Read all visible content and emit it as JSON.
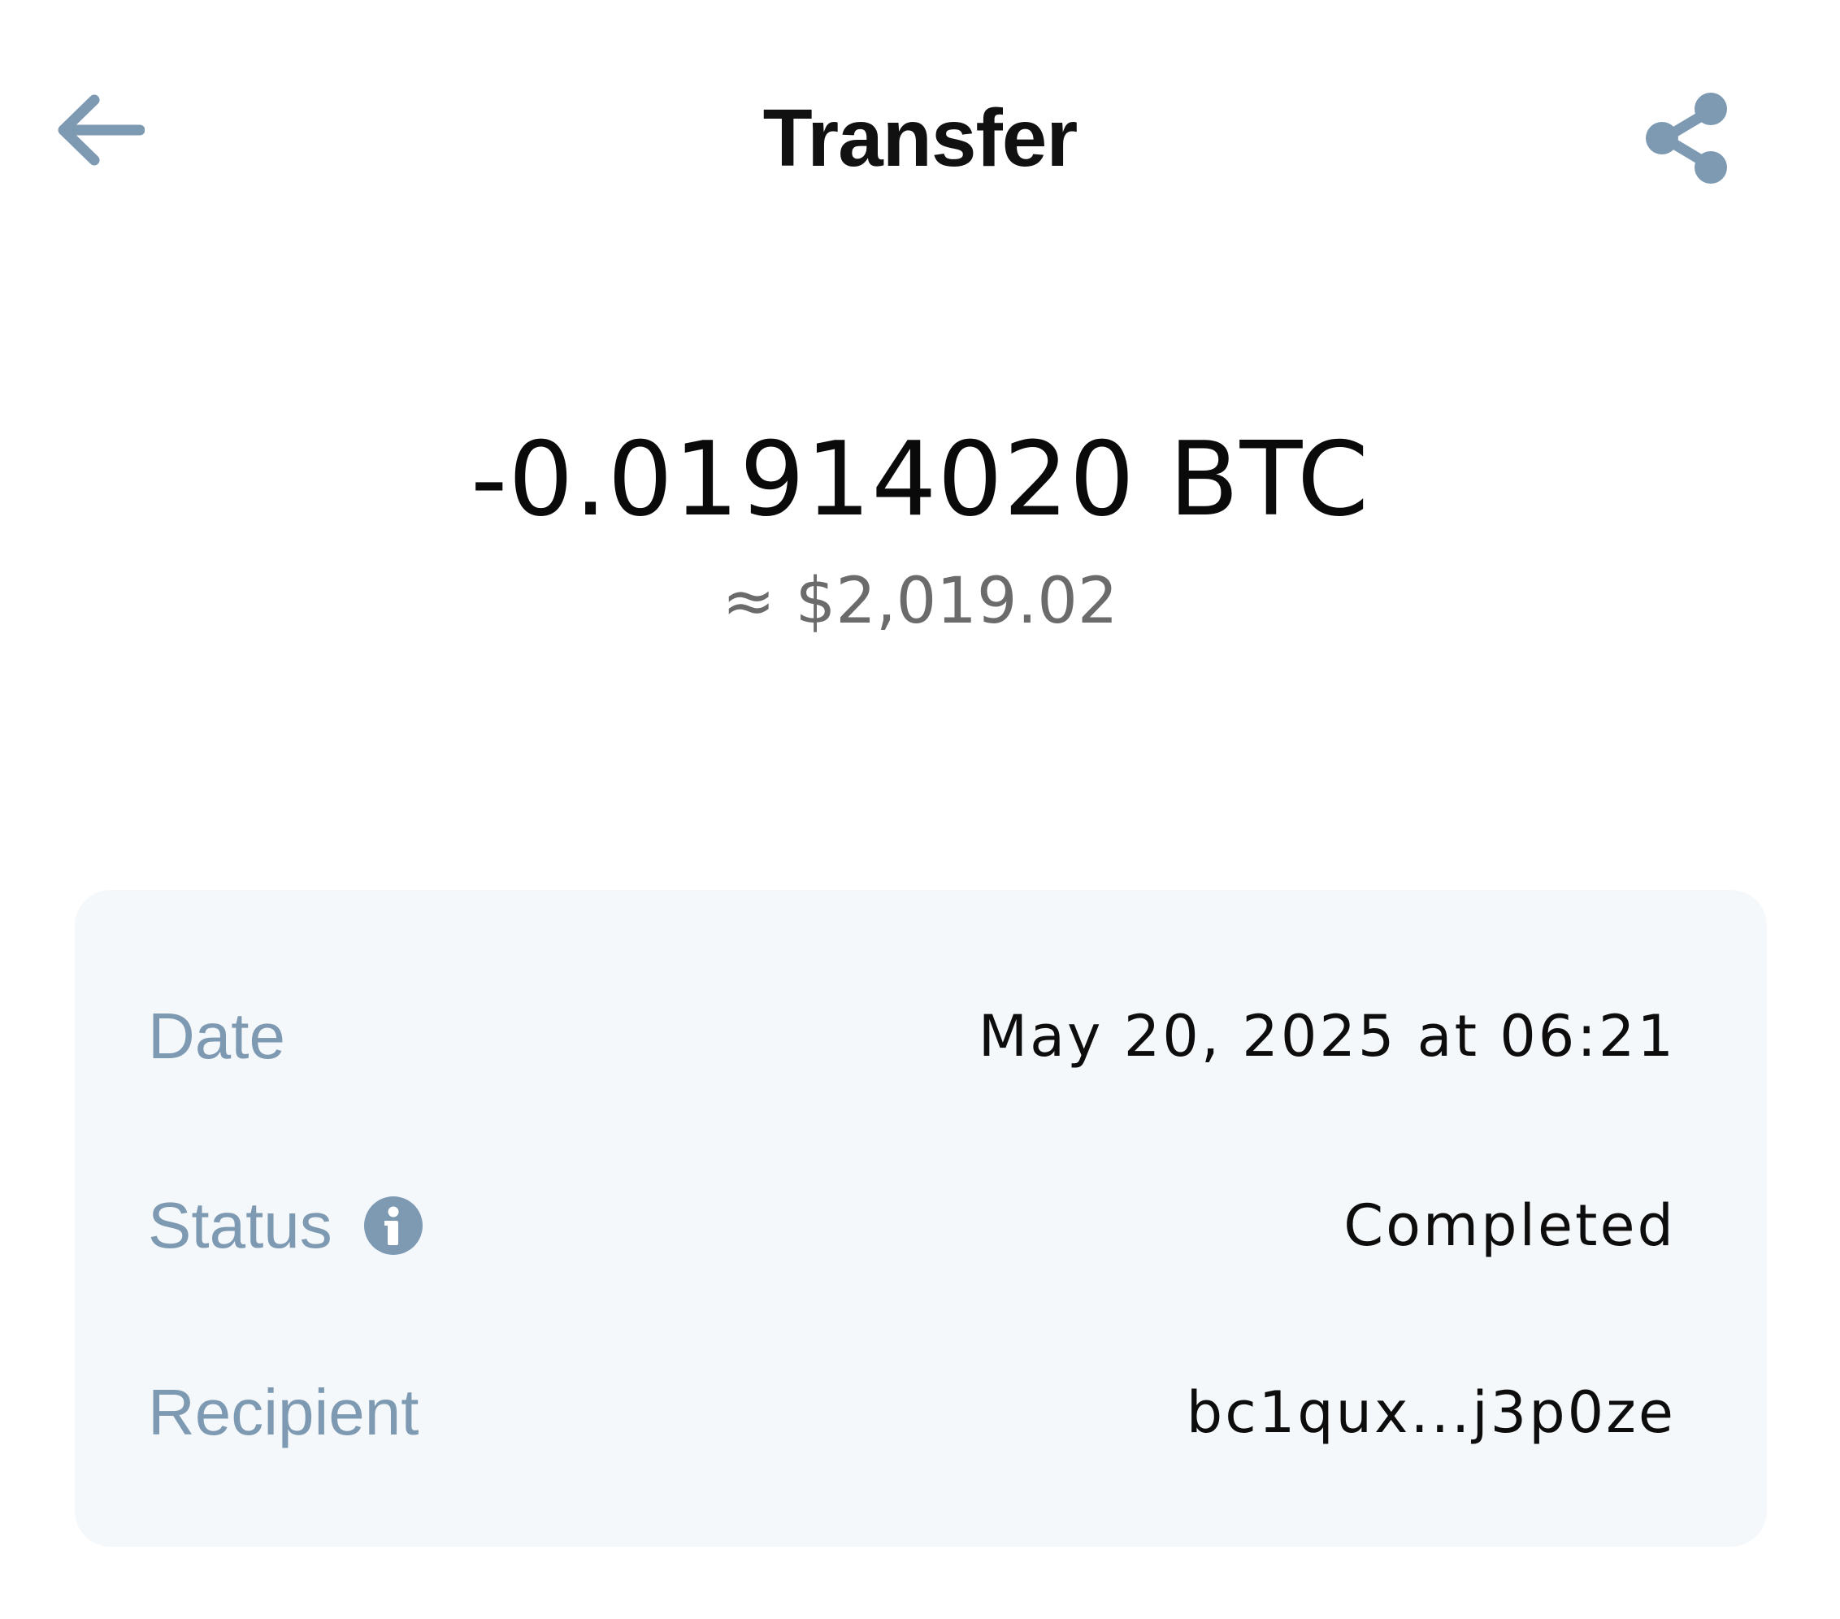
{
  "header": {
    "title": "Transfer",
    "back_icon": "arrow-left-icon",
    "share_icon": "share-icon"
  },
  "transaction": {
    "amount": "-0.01914020 BTC",
    "fiat_value": "≈ $2,019.02"
  },
  "details": {
    "date_label": "Date",
    "date_value": "May 20, 2025 at 06:21",
    "status_label": "Status",
    "status_info_icon": "info-icon",
    "status_value": "Completed",
    "recipient_label": "Recipient",
    "recipient_value": "bc1qux...j3p0ze"
  },
  "colors": {
    "icon": "#7d9ab2",
    "card_background": "#f5f8fb",
    "label": "#7d9ab2",
    "fiat_text": "#6b6b6b"
  }
}
